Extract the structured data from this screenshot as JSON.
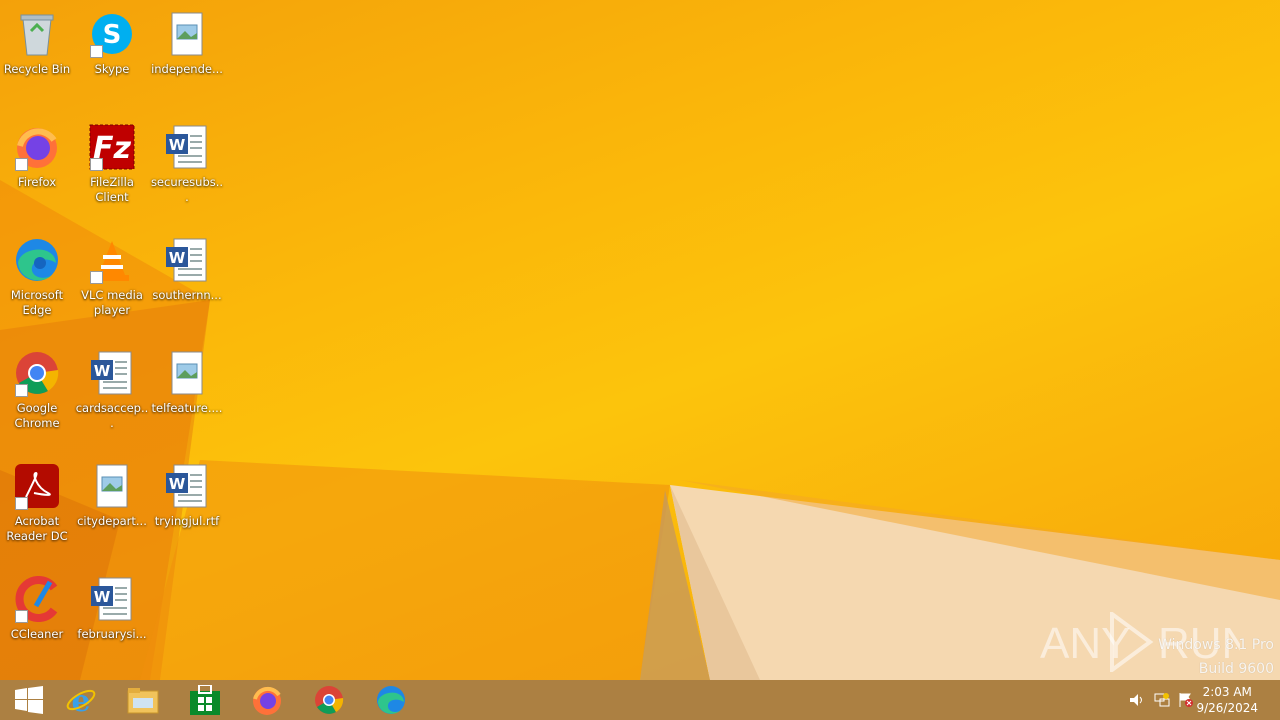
{
  "desktop": {
    "icons": [
      {
        "label": "Recycle Bin",
        "icon": "recycle-bin-icon"
      },
      {
        "label": "Skype",
        "icon": "skype-icon"
      },
      {
        "label": "independe...",
        "icon": "image-file-icon"
      },
      {
        "label": "Firefox",
        "icon": "firefox-icon"
      },
      {
        "label": "FileZilla Client",
        "icon": "filezilla-icon"
      },
      {
        "label": "securesubs...",
        "icon": "word-document-icon"
      },
      {
        "label": "Microsoft Edge",
        "icon": "edge-icon"
      },
      {
        "label": "VLC media player",
        "icon": "vlc-icon"
      },
      {
        "label": "southernn...",
        "icon": "word-document-icon"
      },
      {
        "label": "Google Chrome",
        "icon": "chrome-icon"
      },
      {
        "label": "cardsaccep...",
        "icon": "word-document-icon"
      },
      {
        "label": "telfeature....",
        "icon": "image-file-icon"
      },
      {
        "label": "Acrobat Reader DC",
        "icon": "acrobat-icon"
      },
      {
        "label": "citydepart...",
        "icon": "image-file-icon"
      },
      {
        "label": "tryingjul.rtf",
        "icon": "word-document-icon"
      },
      {
        "label": "CCleaner",
        "icon": "ccleaner-icon"
      },
      {
        "label": "februarysi...",
        "icon": "word-document-icon"
      }
    ],
    "watermark": {
      "brand": "ANY RUN",
      "os_line1": "Windows 8.1 Pro",
      "os_line2": "Build 9600"
    }
  },
  "taskbar": {
    "buttons": [
      "start-button",
      "internet-explorer",
      "file-explorer",
      "store",
      "firefox",
      "chrome",
      "edge"
    ],
    "clock": {
      "time": "2:03 AM",
      "date": "9/26/2024"
    }
  }
}
